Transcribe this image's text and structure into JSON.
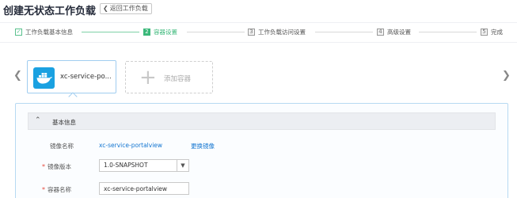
{
  "header": {
    "title": "创建无状态工作负载",
    "back_label": "返回工作负载"
  },
  "steps": [
    {
      "num": "✓",
      "label": "工作负载基本信息",
      "state": "done"
    },
    {
      "num": "2",
      "label": "容器设置",
      "state": "active"
    },
    {
      "num": "3",
      "label": "工作负载访问设置",
      "state": "pending"
    },
    {
      "num": "4",
      "label": "高级设置",
      "state": "pending"
    },
    {
      "num": "5",
      "label": "完成",
      "state": "pending"
    }
  ],
  "containers": {
    "items": [
      {
        "name": "xc-service-po...",
        "icon": "docker-whale-icon"
      }
    ],
    "add_label": "添加容器"
  },
  "basic_info": {
    "section_title": "基本信息",
    "image_name_label": "镜像名称",
    "image_name_value": "xc-service-portalview",
    "change_image_link": "更换镜像",
    "image_version_label": "镜像版本",
    "image_version_value": "1.0-SNAPSHOT",
    "container_name_label": "容器名称",
    "container_name_value": "xc-service-portalview"
  },
  "colors": {
    "accent_green": "#3bb87a",
    "link_blue": "#1476d1",
    "docker_blue": "#1aa1e1",
    "required_red": "#e5483c"
  }
}
